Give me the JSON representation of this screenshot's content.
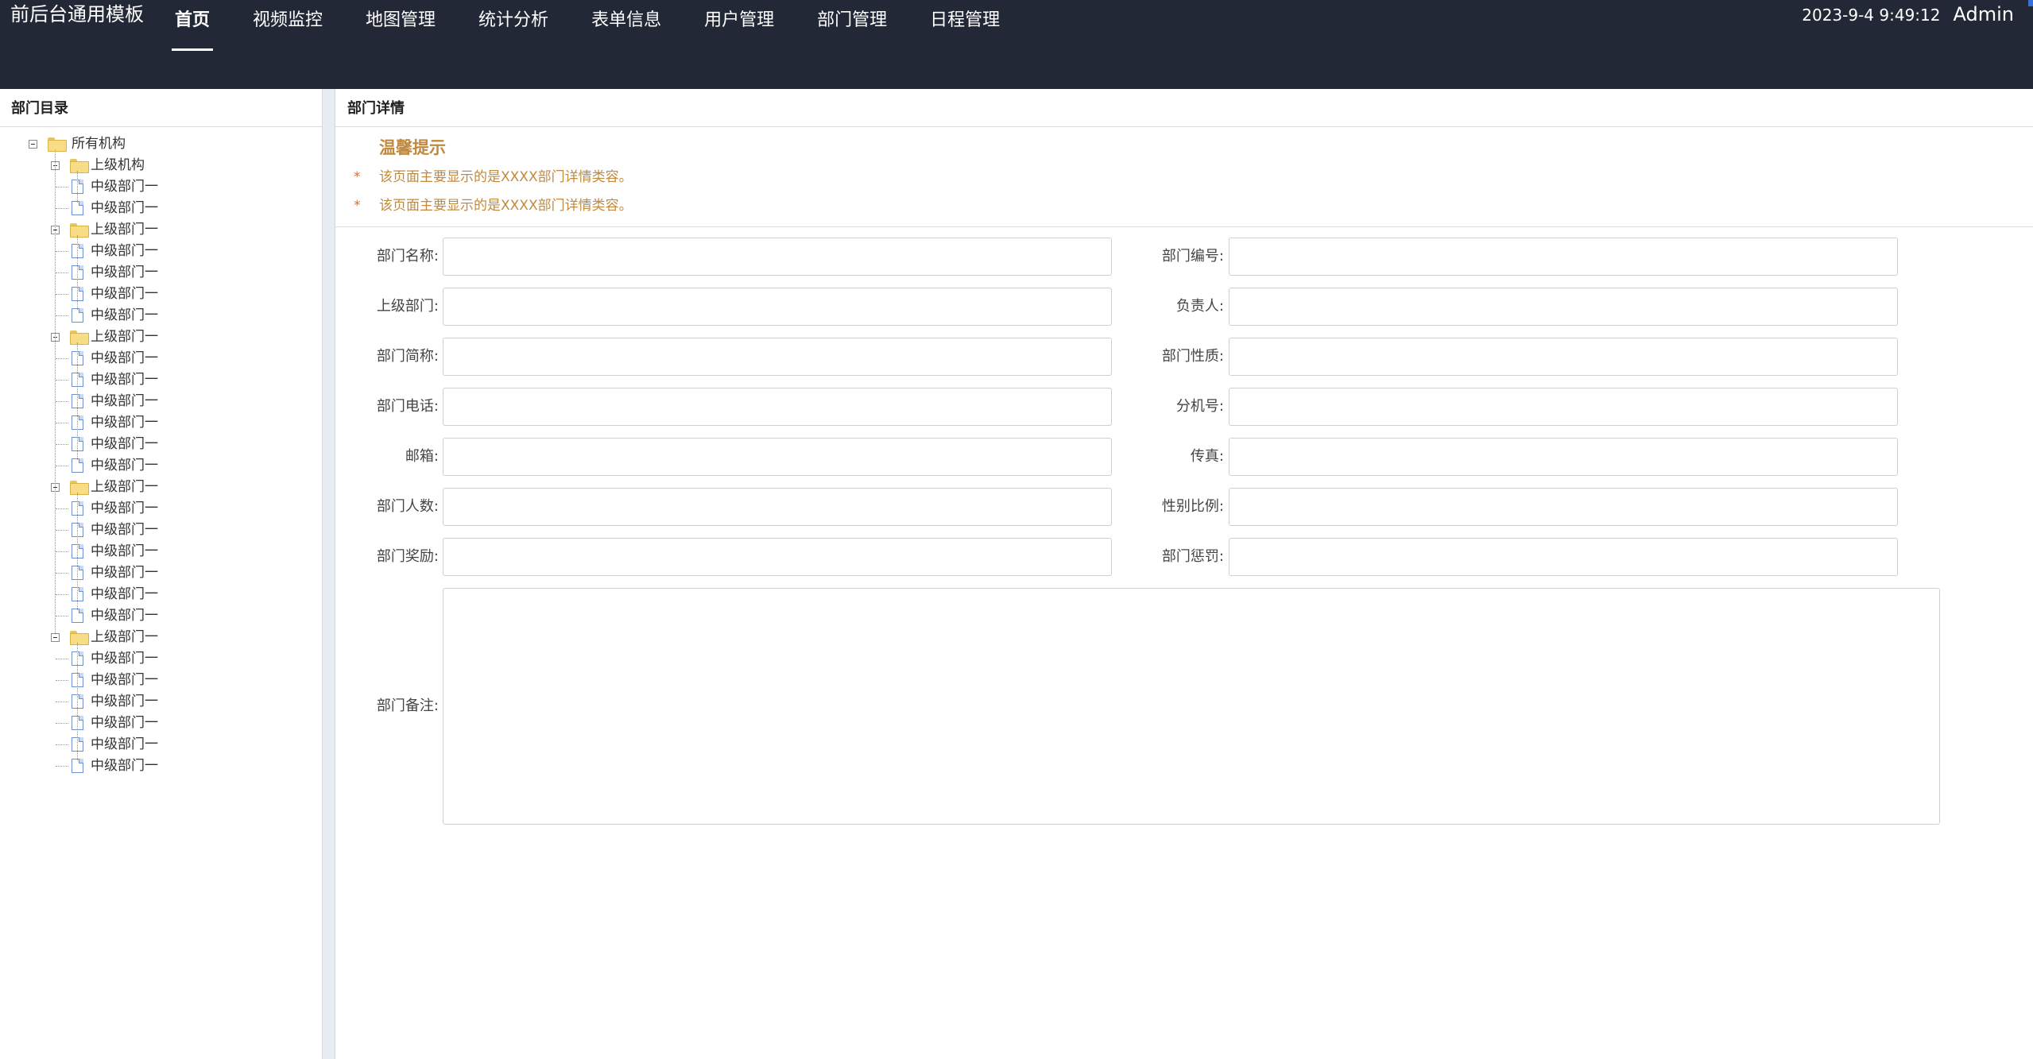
{
  "header": {
    "brand": "前后台通用模板",
    "nav": [
      {
        "label": "首页",
        "active": true
      },
      {
        "label": "视频监控"
      },
      {
        "label": "地图管理"
      },
      {
        "label": "统计分析"
      },
      {
        "label": "表单信息"
      },
      {
        "label": "用户管理"
      },
      {
        "label": "部门管理"
      },
      {
        "label": "日程管理"
      }
    ],
    "clock": "2023-9-4 9:49:12",
    "user": "Admin"
  },
  "sidebar": {
    "title": "部门目录",
    "tree": {
      "root": "所有机构",
      "groups": [
        {
          "label": "上级机构",
          "children": [
            "中级部门一",
            "中级部门一"
          ]
        },
        {
          "label": "上级部门一",
          "children": [
            "中级部门一",
            "中级部门一",
            "中级部门一",
            "中级部门一"
          ]
        },
        {
          "label": "上级部门一",
          "children": [
            "中级部门一",
            "中级部门一",
            "中级部门一",
            "中级部门一",
            "中级部门一",
            "中级部门一"
          ]
        },
        {
          "label": "上级部门一",
          "children": [
            "中级部门一",
            "中级部门一",
            "中级部门一",
            "中级部门一",
            "中级部门一",
            "中级部门一"
          ]
        },
        {
          "label": "上级部门一",
          "children": [
            "中级部门一",
            "中级部门一",
            "中级部门一",
            "中级部门一",
            "中级部门一",
            "中级部门一"
          ]
        }
      ]
    }
  },
  "main": {
    "title": "部门详情",
    "tips": {
      "title": "温馨提示",
      "items": [
        "该页面主要显示的是XXXX部门详情类容。",
        "该页面主要显示的是XXXX部门详情类容。"
      ]
    },
    "form": {
      "rows": [
        [
          {
            "label": "部门名称:",
            "value": ""
          },
          {
            "label": "部门编号:",
            "value": ""
          }
        ],
        [
          {
            "label": "上级部门:",
            "value": ""
          },
          {
            "label": "负责人:",
            "value": ""
          }
        ],
        [
          {
            "label": "部门简称:",
            "value": ""
          },
          {
            "label": "部门性质:",
            "value": ""
          }
        ],
        [
          {
            "label": "部门电话:",
            "value": ""
          },
          {
            "label": "分机号:",
            "value": ""
          }
        ],
        [
          {
            "label": "邮箱:",
            "value": ""
          },
          {
            "label": "传真:",
            "value": ""
          }
        ],
        [
          {
            "label": "部门人数:",
            "value": ""
          },
          {
            "label": "性别比例:",
            "value": ""
          }
        ],
        [
          {
            "label": "部门奖励:",
            "value": ""
          },
          {
            "label": "部门惩罚:",
            "value": ""
          }
        ]
      ],
      "remark": {
        "label": "部门备注:",
        "value": ""
      }
    }
  },
  "colors": {
    "header_bg": "#232837",
    "tip_text": "#c08a3e",
    "tip_star": "#e0702a"
  }
}
